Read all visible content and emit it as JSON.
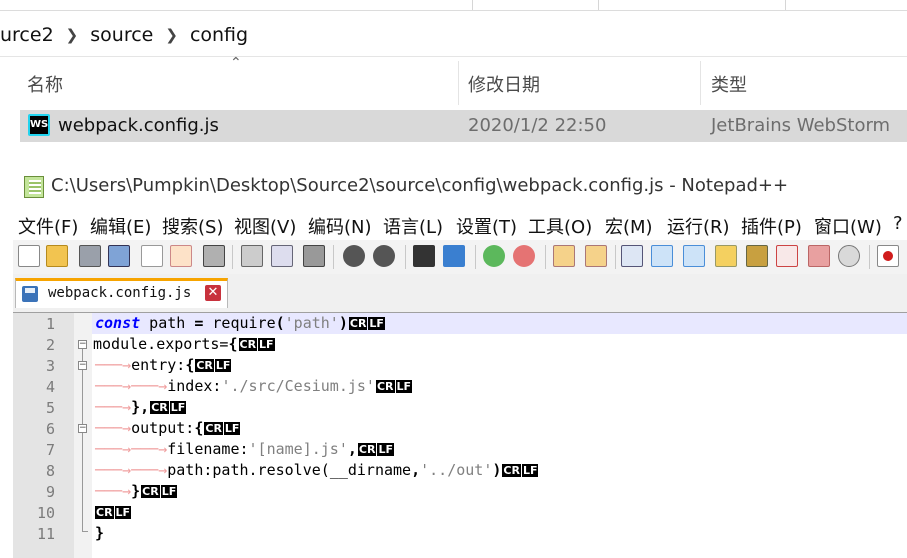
{
  "explorer": {
    "breadcrumb": [
      "urce2",
      "source",
      "config"
    ],
    "columns": {
      "name": "名称",
      "date": "修改日期",
      "type": "类型"
    },
    "file": {
      "name": "webpack.config.js",
      "date": "2020/1/2 22:50",
      "type": "JetBrains WebStorm"
    }
  },
  "npp": {
    "title": "C:\\Users\\Pumpkin\\Desktop\\Source2\\source\\config\\webpack.config.js - Notepad++",
    "menu": [
      "文件(F)",
      "编辑(E)",
      "搜索(S)",
      "视图(V)",
      "编码(N)",
      "语言(L)",
      "设置(T)",
      "工具(O)",
      "宏(M)",
      "运行(R)",
      "插件(P)",
      "窗口(W)",
      "?"
    ],
    "tab": "webpack.config.js",
    "tab_close": "✕",
    "eol": {
      "cr": "CR",
      "lf": "LF"
    },
    "line_numbers": [
      "1",
      "2",
      "3",
      "4",
      "5",
      "6",
      "7",
      "8",
      "9",
      "10",
      "11"
    ],
    "code": {
      "l1_kw": "const",
      "l1_a": " path ",
      "l1_eq": "=",
      "l1_b": " require",
      "l1_p1": "(",
      "l1_str": "'path'",
      "l1_p2": ")",
      "l2": "module.exports=",
      "l2_brace": "{",
      "l3": "entry:",
      "l3_brace": "{",
      "l4": "index:",
      "l4_str": "'./src/Cesium.js'",
      "l5": "},",
      "l6": "output:",
      "l6_brace": "{",
      "l7": "filename:",
      "l7_str": "'[name].js'",
      "l7_c": ",",
      "l8": "path:path.resolve(",
      "l8_dn": "__dirname",
      "l8_c": ",",
      "l8_str": "'../out'",
      "l8_p": ")",
      "l9": "}",
      "l11": "}"
    }
  }
}
